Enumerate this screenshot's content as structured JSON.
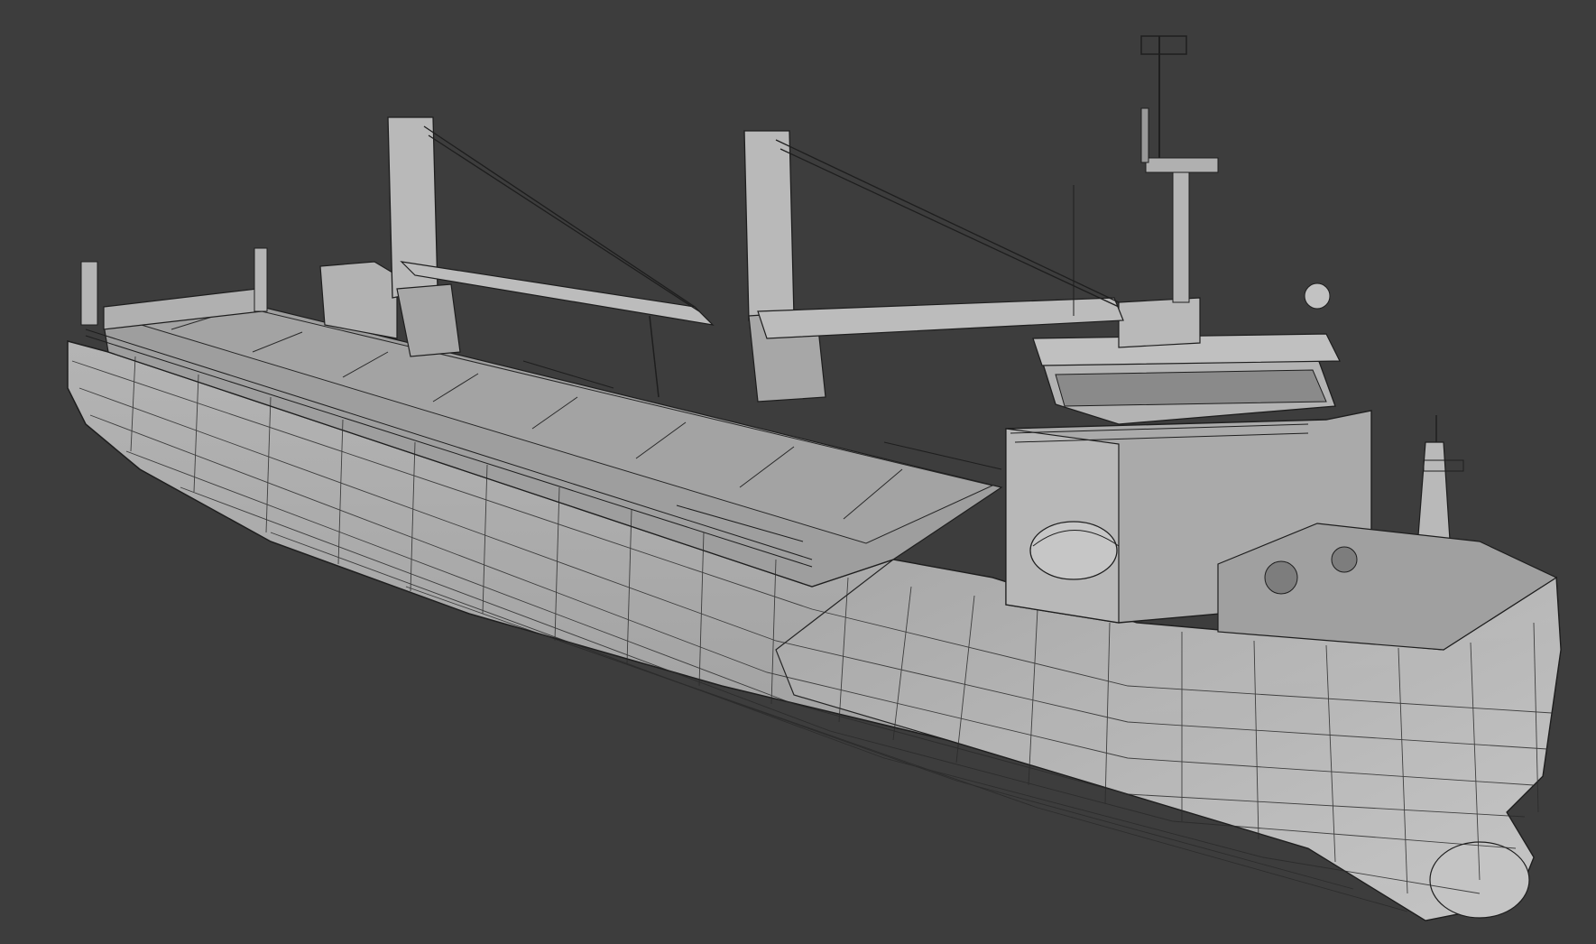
{
  "scene": {
    "subject": "cargo-ship-wireframe-render",
    "colors": {
      "background": "#3d3d3d",
      "hull_light": "#b9b9b9",
      "hull_mid": "#a6a6a6",
      "hull_dark": "#8f8f8f",
      "deck": "#9b9b9b",
      "superstructure": "#acacac",
      "wire": "#2a2a2a",
      "edge": "#1e1e1e"
    },
    "elements": {
      "cranes": 2,
      "masts": 2,
      "lifeboats": 1,
      "hatch_covers": 8
    }
  }
}
